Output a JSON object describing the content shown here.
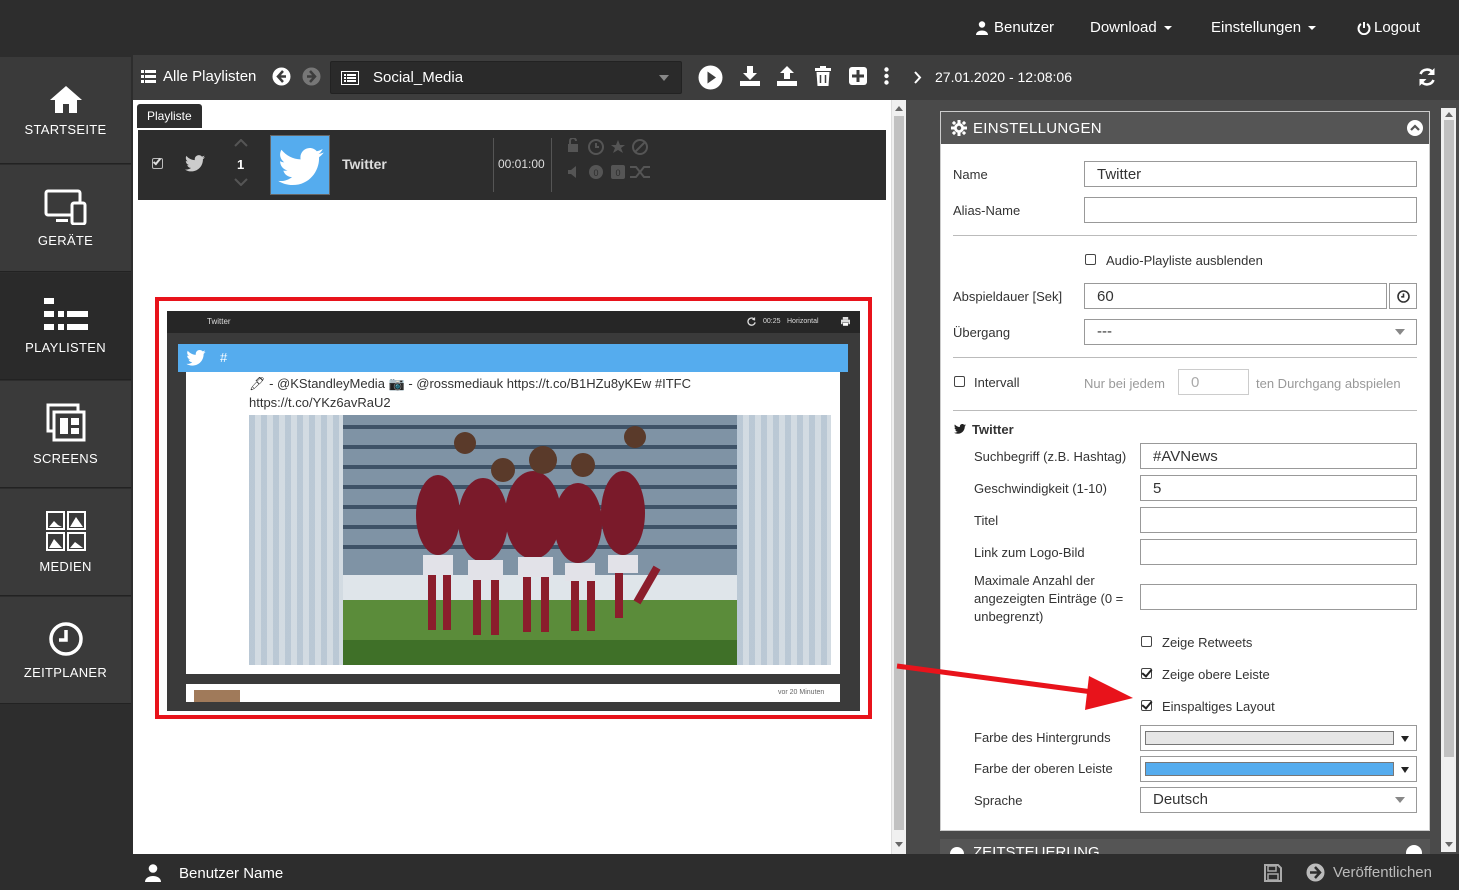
{
  "topbar": {
    "user_label": "Benutzer",
    "download_label": "Download",
    "settings_label": "Einstellungen",
    "logout_label": "Logout"
  },
  "sidebar": {
    "items": [
      {
        "label": "STARTSEITE"
      },
      {
        "label": "GERÄTE"
      },
      {
        "label": "PLAYLISTEN"
      },
      {
        "label": "SCREENS"
      },
      {
        "label": "MEDIEN"
      },
      {
        "label": "ZEITPLANER"
      }
    ]
  },
  "playlist_toolbar": {
    "all_playlists_label": "Alle Playlisten",
    "selected_playlist": "Social_Media"
  },
  "playlist": {
    "tab_label": "Playliste",
    "row": {
      "index": "1",
      "name": "Twitter",
      "duration": "00:01:00"
    }
  },
  "preview": {
    "title": "Twitter",
    "time": "00:25",
    "orientation": "Horizontal",
    "hashtag": "#",
    "tweet_text": "🖊 - @KStandleyMedia 📷 - @rossmediauk https://t.co/B1HZu8yKEw #ITFC https://t.co/YKz6avRaU2",
    "timestamp": "vor 20 Minuten"
  },
  "right_header": {
    "datetime": "27.01.2020 - 12:08:06"
  },
  "settings": {
    "header": "EINSTELLUNGEN",
    "name_label": "Name",
    "name_value": "Twitter",
    "alias_label": "Alias-Name",
    "alias_value": "",
    "hide_audio_label": "Audio-Playliste ausblenden",
    "duration_label": "Abspieldauer [Sek]",
    "duration_value": "60",
    "transition_label": "Übergang",
    "transition_value": "---",
    "interval_label": "Intervall",
    "interval_prefix": "Nur bei jedem",
    "interval_value": "0",
    "interval_suffix": "ten Durchgang abspielen",
    "twitter_section": "Twitter",
    "search_label": "Suchbegriff (z.B. Hashtag)",
    "search_value": "#AVNews",
    "speed_label": "Geschwindigkeit (1-10)",
    "speed_value": "5",
    "title_label": "Titel",
    "title_value": "",
    "logo_label": "Link zum Logo-Bild",
    "logo_value": "",
    "max_label": "Maximale Anzahl der angezeigten Einträge (0 = unbegrenzt)",
    "max_value": "",
    "retweets_label": "Zeige Retweets",
    "topbar_label": "Zeige obere Leiste",
    "onecol_label": "Einspaltiges Layout",
    "bg_color_label": "Farbe des Hintergrunds",
    "bg_color": "#e6e6e6",
    "bar_color_label": "Farbe der oberen Leiste",
    "bar_color": "#55acee",
    "language_label": "Sprache",
    "language_value": "Deutsch",
    "next_section": "ZEITSTEUERUNG"
  },
  "bottombar": {
    "username": "Benutzer Name",
    "publish_label": "Veröffentlichen"
  },
  "colors": {
    "accent_red": "#e8131b",
    "twitter_blue": "#55acee"
  }
}
